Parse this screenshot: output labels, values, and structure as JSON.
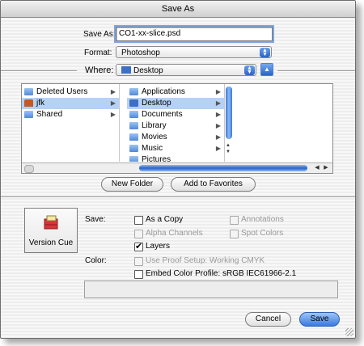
{
  "window": {
    "title": "Save As"
  },
  "save_as": {
    "label": "Save As:",
    "value": "CO1-xx-slice.psd"
  },
  "format": {
    "label": "Format:",
    "selected": "Photoshop"
  },
  "where": {
    "label": "Where:",
    "selected": "Desktop"
  },
  "browser": {
    "col1": [
      {
        "label": "Deleted Users",
        "arrow": "▶",
        "selected": false
      },
      {
        "label": "jfk",
        "arrow": "▶",
        "selected": true
      },
      {
        "label": "Shared",
        "arrow": "▶",
        "selected": false
      }
    ],
    "col2": [
      {
        "label": "Applications",
        "arrow": "▶",
        "selected": false
      },
      {
        "label": "Desktop",
        "arrow": "▶",
        "selected": true
      },
      {
        "label": "Documents",
        "arrow": "▶",
        "selected": false
      },
      {
        "label": "Library",
        "arrow": "▶",
        "selected": false
      },
      {
        "label": "Movies",
        "arrow": "▶",
        "selected": false
      },
      {
        "label": "Music",
        "arrow": "▶",
        "selected": false
      },
      {
        "label": "Pictures",
        "arrow": "",
        "selected": false
      }
    ]
  },
  "buttons": {
    "new_folder": "New Folder",
    "add_favorites": "Add to Favorites",
    "cancel": "Cancel",
    "save": "Save"
  },
  "version_cue": {
    "label": "Version Cue"
  },
  "save_options": {
    "label": "Save:",
    "as_copy": {
      "label": "As a Copy",
      "checked": false,
      "enabled": true
    },
    "annotations": {
      "label": "Annotations",
      "checked": false,
      "enabled": false
    },
    "alpha_channels": {
      "label": "Alpha Channels",
      "checked": false,
      "enabled": false
    },
    "spot_colors": {
      "label": "Spot Colors",
      "checked": false,
      "enabled": false
    },
    "layers": {
      "label": "Layers",
      "checked": true,
      "enabled": true
    }
  },
  "color_options": {
    "label": "Color:",
    "use_proof": {
      "label": "Use Proof Setup:  Working CMYK",
      "checked": false,
      "enabled": false
    },
    "embed_profile": {
      "label": "Embed Color Profile:  sRGB IEC61966-2.1",
      "checked": false,
      "enabled": true
    }
  },
  "icons": {
    "folder": "folder-icon",
    "home": "home-icon",
    "up": "up-arrow-icon",
    "scroll_left": "scroll-left-icon",
    "scroll_right": "scroll-right-icon"
  },
  "colors": {
    "accent": "#2a63c7",
    "selection": "#b5d1f5"
  }
}
